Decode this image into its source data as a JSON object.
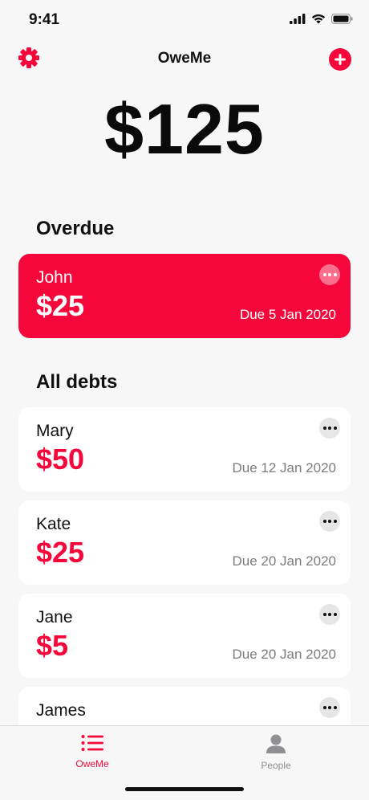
{
  "status_bar": {
    "time": "9:41"
  },
  "nav": {
    "title": "OweMe",
    "settings_icon": "gear-icon",
    "add_icon": "plus-circle-icon"
  },
  "total": "$125",
  "overdue": {
    "title": "Overdue",
    "items": [
      {
        "name": "John",
        "amount": "$25",
        "due": "Due 5 Jan 2020"
      }
    ]
  },
  "all_debts": {
    "title": "All debts",
    "items": [
      {
        "name": "Mary",
        "amount": "$50",
        "due": "Due 12 Jan 2020"
      },
      {
        "name": "Kate",
        "amount": "$25",
        "due": "Due 20 Jan 2020"
      },
      {
        "name": "Jane",
        "amount": "$5",
        "due": "Due 20 Jan 2020"
      },
      {
        "name": "James",
        "amount": "",
        "due": ""
      }
    ]
  },
  "tab_bar": {
    "items": [
      {
        "label": "OweMe",
        "icon": "list-icon",
        "active": true
      },
      {
        "label": "People",
        "icon": "person-icon",
        "active": false
      }
    ]
  },
  "colors": {
    "accent": "#f5073b",
    "background": "#f7f7f7",
    "card": "#ffffff",
    "muted_text": "#7c7c7c"
  }
}
